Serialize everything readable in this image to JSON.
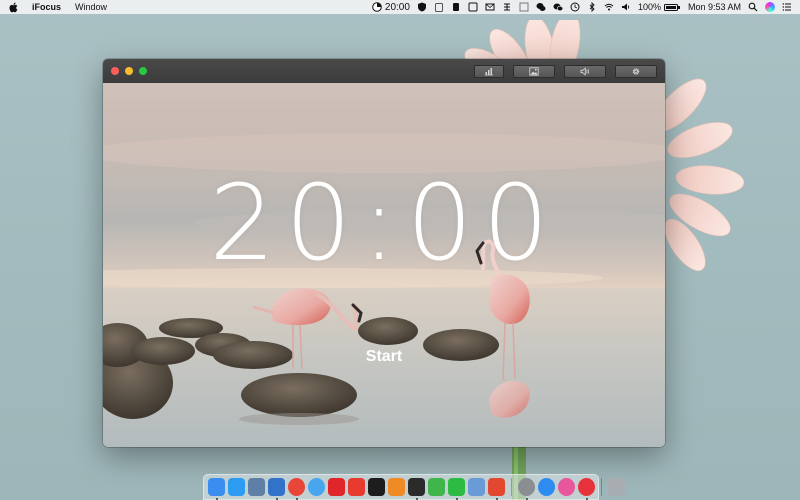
{
  "menubar": {
    "apple_icon": "apple-logo-icon",
    "app_name": "iFocus",
    "menus": [
      "Window"
    ],
    "status": {
      "timer_text": "20:00",
      "battery_percent": "100%",
      "battery_level": 1.0,
      "clock": "Mon 9:53 AM"
    }
  },
  "window": {
    "toolbar_icons": [
      "stats-chart-icon",
      "image-icon",
      "sound-icon",
      "gear-icon"
    ],
    "timer": "20:00",
    "start_label": "Start"
  },
  "dock": {
    "apps": [
      {
        "name": "finder",
        "color": "#3b8ef0",
        "running": true
      },
      {
        "name": "launchpad",
        "color": "#2c9cf3",
        "running": false
      },
      {
        "name": "mission-control",
        "color": "#5e7fa6",
        "running": false
      },
      {
        "name": "xcode",
        "color": "#3372c9",
        "running": true
      },
      {
        "name": "chrome",
        "color": "#e9463a",
        "running": true
      },
      {
        "name": "safari",
        "color": "#49a6ee",
        "running": false
      },
      {
        "name": "netease-music",
        "color": "#e0262b",
        "running": false
      },
      {
        "name": "weibo",
        "color": "#e63b2e",
        "running": false
      },
      {
        "name": "qq",
        "color": "#1d1d1d",
        "running": false
      },
      {
        "name": "sketch",
        "color": "#f08a24",
        "running": false
      },
      {
        "name": "terminal",
        "color": "#2b2b2b",
        "running": true
      },
      {
        "name": "evernote",
        "color": "#3fb54a",
        "running": false
      },
      {
        "name": "wechat",
        "color": "#2dbb43",
        "running": true
      },
      {
        "name": "preview",
        "color": "#6a9bd6",
        "running": false
      },
      {
        "name": "flashcard",
        "color": "#e2482f",
        "running": true
      },
      {
        "name": "system-preferences",
        "color": "#8a8d92",
        "running": true
      },
      {
        "name": "app-store",
        "color": "#2e8cf0",
        "running": false
      },
      {
        "name": "itunes",
        "color": "#e8579d",
        "running": false
      },
      {
        "name": "ifocus",
        "color": "#e8323b",
        "running": true
      },
      {
        "name": "trash",
        "color": "#a7adb1",
        "running": false
      }
    ]
  }
}
